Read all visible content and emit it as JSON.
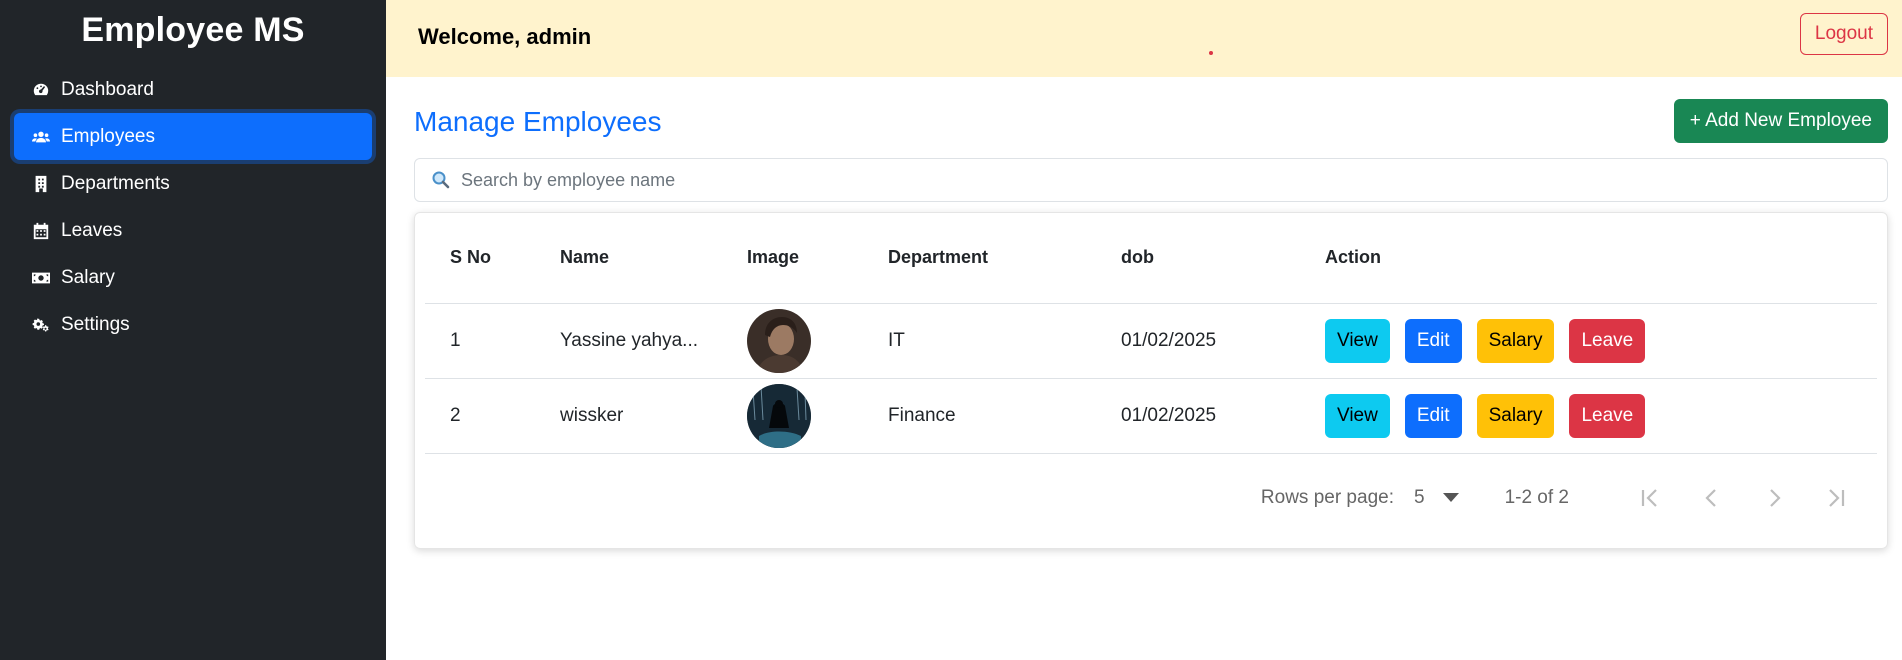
{
  "sidebar": {
    "brand": "Employee MS",
    "items": [
      {
        "label": "Dashboard",
        "icon": "gauge-icon",
        "active": false
      },
      {
        "label": "Employees",
        "icon": "users-icon",
        "active": true
      },
      {
        "label": "Departments",
        "icon": "building-icon",
        "active": false
      },
      {
        "label": "Leaves",
        "icon": "calendar-icon",
        "active": false
      },
      {
        "label": "Salary",
        "icon": "money-icon",
        "active": false
      },
      {
        "label": "Settings",
        "icon": "cogs-icon",
        "active": false
      }
    ]
  },
  "topbar": {
    "welcome": "Welcome, admin",
    "logout_label": "Logout"
  },
  "main": {
    "title": "Manage Employees",
    "add_label": "+ Add New Employee",
    "search_placeholder": "Search by employee name"
  },
  "table": {
    "headers": [
      "S No",
      "Name",
      "Image",
      "Department",
      "dob",
      "Action"
    ],
    "rows": [
      {
        "sno": "1",
        "name": "Yassine yahya...",
        "department": "IT",
        "dob": "01/02/2025"
      },
      {
        "sno": "2",
        "name": "wissker",
        "department": "Finance",
        "dob": "01/02/2025"
      }
    ],
    "actions": {
      "view": "View",
      "edit": "Edit",
      "salary": "Salary",
      "leave": "Leave"
    }
  },
  "pagination": {
    "rows_per_page_label": "Rows per page:",
    "rows_per_page_value": "5",
    "range": "1-2 of 2"
  },
  "colors": {
    "sidebar_bg": "#212529",
    "active": "#0d6efd",
    "topbar_bg": "#fff3cd",
    "add_button": "#198754",
    "view": "#0dcaf0",
    "salary": "#ffc107",
    "leave": "#dc3545"
  }
}
